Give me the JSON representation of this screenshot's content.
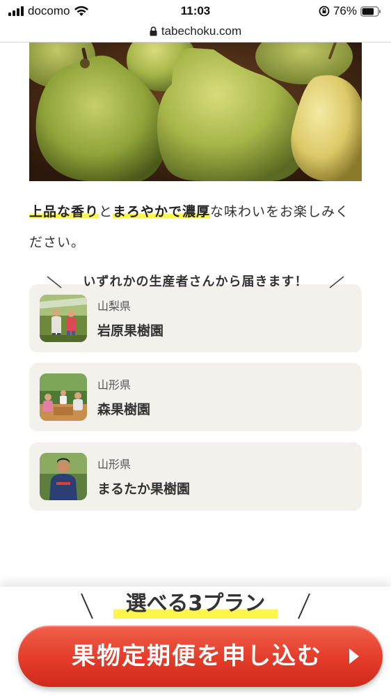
{
  "status_bar": {
    "carrier": "docomo",
    "time": "11:03",
    "battery_percent": "76%",
    "battery_level": 0.76
  },
  "browser": {
    "url": "tabechoku.com"
  },
  "description": {
    "highlight_1": "上品な香り",
    "text_1": "と",
    "highlight_2": "まろやかで濃厚",
    "text_2": "な味わいをお楽しみください。"
  },
  "producers": {
    "heading": "いずれかの生産者さんから届きます！",
    "items": [
      {
        "prefecture": "山梨県",
        "name": "岩原果樹園"
      },
      {
        "prefecture": "山形県",
        "name": "森果樹園"
      },
      {
        "prefecture": "山形県",
        "name": "まるたか果樹園"
      }
    ]
  },
  "cta": {
    "plan_heading": "選べる3プラン",
    "button_label": "果物定期便を申し込む"
  },
  "colors": {
    "highlight": "#fff64d",
    "card_bg": "#f3f1ec",
    "cta_red": "#e43b2a"
  }
}
